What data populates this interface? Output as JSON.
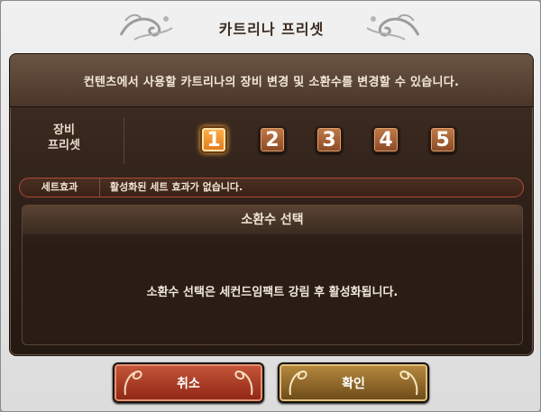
{
  "window": {
    "title": "카트리나 프리셋"
  },
  "description": "컨텐츠에서 사용할 카트리나의 장비 변경 및 소환수를 변경할 수 있습니다.",
  "preset": {
    "label": "장비\n프리셋",
    "buttons": [
      "1",
      "2",
      "3",
      "4",
      "5"
    ],
    "selected": "1"
  },
  "set_effect": {
    "label": "세트효과",
    "value": "활성화된 세트 효과가 없습니다."
  },
  "summon": {
    "header": "소환수 선택",
    "message": "소환수 선택은 세컨드임팩트 강림 후 활성화됩니다."
  },
  "footer": {
    "cancel_label": "취소",
    "ok_label": "확인"
  },
  "colors": {
    "accent_orange": "#e0781c",
    "cancel_red": "#8e2614",
    "ok_gold": "#6b4a18",
    "panel_dark": "#2b1e17"
  }
}
